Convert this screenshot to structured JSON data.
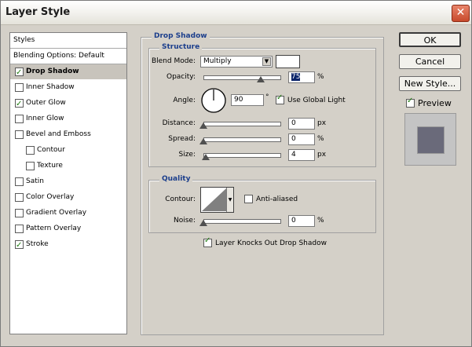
{
  "window": {
    "title": "Layer Style",
    "close_glyph": "✕"
  },
  "styles_panel": {
    "header": "Styles",
    "items": [
      {
        "label": "Blending Options: Default",
        "checkbox": false,
        "checked": false,
        "indent": 0
      },
      {
        "label": "Drop Shadow",
        "checkbox": true,
        "checked": true,
        "indent": 0,
        "selected": true
      },
      {
        "label": "Inner Shadow",
        "checkbox": true,
        "checked": false,
        "indent": 0
      },
      {
        "label": "Outer Glow",
        "checkbox": true,
        "checked": true,
        "indent": 0
      },
      {
        "label": "Inner Glow",
        "checkbox": true,
        "checked": false,
        "indent": 0
      },
      {
        "label": "Bevel and Emboss",
        "checkbox": true,
        "checked": false,
        "indent": 0
      },
      {
        "label": "Contour",
        "checkbox": true,
        "checked": false,
        "indent": 1
      },
      {
        "label": "Texture",
        "checkbox": true,
        "checked": false,
        "indent": 1
      },
      {
        "label": "Satin",
        "checkbox": true,
        "checked": false,
        "indent": 0
      },
      {
        "label": "Color Overlay",
        "checkbox": true,
        "checked": false,
        "indent": 0
      },
      {
        "label": "Gradient Overlay",
        "checkbox": true,
        "checked": false,
        "indent": 0
      },
      {
        "label": "Pattern Overlay",
        "checkbox": true,
        "checked": false,
        "indent": 0
      },
      {
        "label": "Stroke",
        "checkbox": true,
        "checked": true,
        "indent": 0
      }
    ]
  },
  "drop_shadow": {
    "title": "Drop Shadow",
    "structure": {
      "title": "Structure",
      "blend_mode_label": "Blend Mode:",
      "blend_mode_value": "Multiply",
      "shadow_color": "#ffffff",
      "opacity_label": "Opacity:",
      "opacity_value": "75",
      "opacity_unit": "%",
      "opacity_fraction": 0.75,
      "angle_label": "Angle:",
      "angle_value": "90",
      "angle_unit": "°",
      "use_global_light_label": "Use Global Light",
      "use_global_light": true,
      "distance_label": "Distance:",
      "distance_value": "0",
      "distance_unit": "px",
      "spread_label": "Spread:",
      "spread_value": "0",
      "spread_unit": "%",
      "size_label": "Size:",
      "size_value": "4",
      "size_unit": "px"
    },
    "quality": {
      "title": "Quality",
      "contour_label": "Contour:",
      "anti_aliased_label": "Anti-aliased",
      "anti_aliased": false,
      "noise_label": "Noise:",
      "noise_value": "0",
      "noise_unit": "%"
    },
    "knocks_out_label": "Layer Knocks Out Drop Shadow",
    "knocks_out": true
  },
  "buttons": {
    "ok": "OK",
    "cancel": "Cancel",
    "new_style": "New Style..."
  },
  "preview": {
    "label": "Preview",
    "checked": true,
    "swatch_color": "#6a6a7a"
  }
}
